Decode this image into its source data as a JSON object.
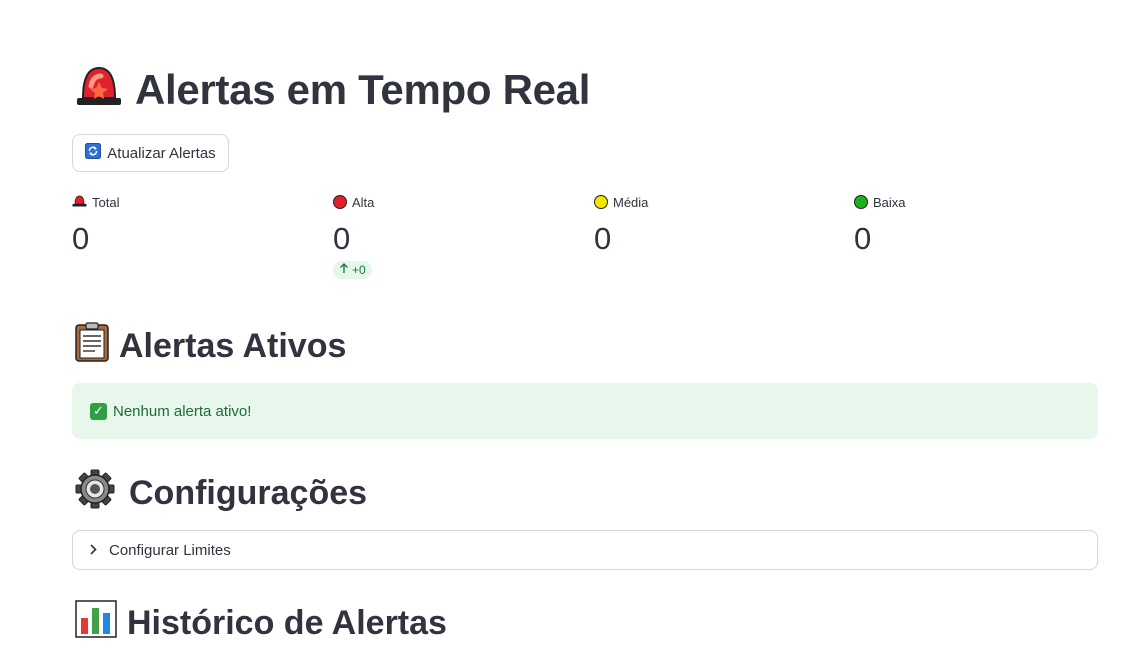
{
  "title": "Alertas em Tempo Real",
  "refresh_button": "Atualizar Alertas",
  "metrics": [
    {
      "label": "Total",
      "value": "0",
      "color": "#e53935"
    },
    {
      "label": "Alta",
      "value": "0",
      "delta": "+0",
      "color": "#e0212e"
    },
    {
      "label": "Média",
      "value": "0",
      "color": "#f5e400"
    },
    {
      "label": "Baixa",
      "value": "0",
      "color": "#1db11d"
    }
  ],
  "sections": {
    "active_title": "Alertas Ativos",
    "active_message": "Nenhum alerta ativo!",
    "config_title": "Configurações",
    "config_expander": "Configurar Limites",
    "history_title": "Histórico de Alertas"
  },
  "colors": {
    "text": "#31333f",
    "success_bg": "#e8f7ec",
    "success_text": "#1e6b3a",
    "delta_green": "#1a7f37"
  },
  "icons": {
    "title": "siren-icon",
    "refresh": "refresh-icon",
    "active": "clipboard-icon",
    "config": "gear-icon",
    "history": "bar-chart-icon"
  }
}
